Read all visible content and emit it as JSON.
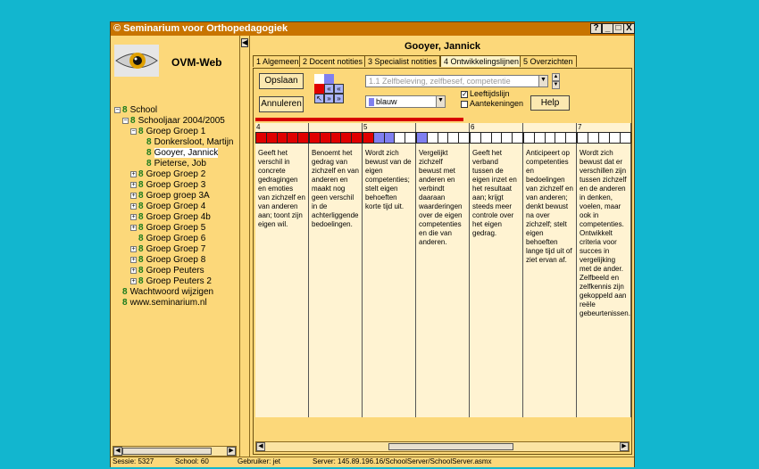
{
  "window": {
    "title": "© Seminarium voor Orthopedagogiek",
    "controls": [
      "?",
      "_",
      "□",
      "X"
    ]
  },
  "app_name": "OVM-Web",
  "tree": [
    {
      "label": "School",
      "toggle": "-",
      "level": 0
    },
    {
      "label": "Schooljaar 2004/2005",
      "toggle": "-",
      "level": 1
    },
    {
      "label": "Groep Groep 1",
      "toggle": "-",
      "level": 2
    },
    {
      "label": "Donkersloot, Martijn",
      "toggle": "",
      "level": 3
    },
    {
      "label": "Gooyer, Jannick",
      "toggle": "",
      "level": 3,
      "selected": true
    },
    {
      "label": "Pieterse, Job",
      "toggle": "",
      "level": 3
    },
    {
      "label": "Groep Groep 2",
      "toggle": "+",
      "level": 2
    },
    {
      "label": "Groep Groep 3",
      "toggle": "+",
      "level": 2
    },
    {
      "label": "Groep groep 3A",
      "toggle": "+",
      "level": 2
    },
    {
      "label": "Groep Groep 4",
      "toggle": "+",
      "level": 2
    },
    {
      "label": "Groep Groep 4b",
      "toggle": "+",
      "level": 2
    },
    {
      "label": "Groep Groep 5",
      "toggle": "+",
      "level": 2
    },
    {
      "label": "Groep Groep 6",
      "toggle": "",
      "level": 2
    },
    {
      "label": "Groep Groep 7",
      "toggle": "+",
      "level": 2
    },
    {
      "label": "Groep Groep 8",
      "toggle": "+",
      "level": 2
    },
    {
      "label": "Groep Peuters",
      "toggle": "+",
      "level": 2
    },
    {
      "label": "Groep Peuters 2",
      "toggle": "+",
      "level": 2
    },
    {
      "label": "Wachtwoord wijzigen",
      "toggle": "",
      "level": 0
    },
    {
      "label": "www.seminarium.nl",
      "toggle": "",
      "level": 0
    }
  ],
  "student_name": "Gooyer, Jannick",
  "tabs": [
    "1 Algemeen",
    "2 Docent notities",
    "3 Specialist notities",
    "4 Ontwikkelingslijnen",
    "5 Overzichten"
  ],
  "active_tab": 3,
  "buttons": {
    "save": "Opslaan",
    "cancel": "Annuleren",
    "help": "Help"
  },
  "nav_glyphs": {
    "prev": "«",
    "next": "»",
    "first": "«",
    "last": "»",
    "up": "↖"
  },
  "domain_select": "1.1 Zelfbeleving, zelfbesef, competentie",
  "color_select": "blauw",
  "checkboxes": [
    {
      "label": "Leeftijdslijn",
      "checked": true
    },
    {
      "label": "Aantekeningen",
      "checked": false
    }
  ],
  "columns": [
    {
      "num": "4",
      "cells": [
        "#e00000",
        "#e00000",
        "#e00000",
        "#e00000",
        "#e00000"
      ],
      "text": "Geeft het verschil in concrete gedragingen en emoties van zichzelf en van anderen aan; toont zijn eigen wil."
    },
    {
      "num": "",
      "cells": [
        "#e00000",
        "#e00000",
        "#e00000",
        "#e00000",
        "#e00000"
      ],
      "text": "Benoemt het gedrag van zichzelf en van anderen en maakt nog geen verschil in de achterliggende bedoelingen."
    },
    {
      "num": "5",
      "cells": [
        "#e00000",
        "#8080f0",
        "#8080f0",
        "#ffffff",
        "#ffffff"
      ],
      "text": "Wordt zich bewust van de eigen competenties; stelt eigen behoeften korte tijd uit."
    },
    {
      "num": "",
      "cells": [
        "#8080f0",
        "#ffffff",
        "#ffffff",
        "#ffffff",
        "#ffffff"
      ],
      "text": "Vergelijkt zichzelf bewust met anderen en verbindt daaraan waarderingen over de eigen competenties en die van anderen."
    },
    {
      "num": "6",
      "cells": [
        "#ffffff",
        "#ffffff",
        "#ffffff",
        "#ffffff",
        "#ffffff"
      ],
      "text": "Geeft het verband tussen de eigen inzet en het resultaat aan; krijgt steeds meer controle over het eigen gedrag."
    },
    {
      "num": "",
      "cells": [
        "#ffffff",
        "#ffffff",
        "#ffffff",
        "#ffffff",
        "#ffffff"
      ],
      "text": "Anticipeert op competenties en bedoelingen van zichzelf en van anderen; denkt bewust na over zichzelf; stelt eigen behoeften lange tijd uit of ziet ervan af."
    },
    {
      "num": "7",
      "cells": [
        "#ffffff",
        "#ffffff",
        "#ffffff",
        "#ffffff",
        "#ffffff"
      ],
      "text": "Wordt zich bewust dat er verschillen zijn tussen zichzelf en de anderen in denken, voelen, maar ook in competenties. Ontwikkelt criteria voor succes in vergelijking met de ander. Zelfbeeld en zelfkennis zijn gekoppeld aan reële gebeurtenissen."
    }
  ],
  "status": {
    "sessie": "Sessie: 5327",
    "school": "School: 60",
    "gebruiker": "Gebruiker: jet",
    "server": "Server: 145.89.196.16/SchoolServer/SchoolServer.asmx"
  },
  "colors": {
    "background": "#12b6cf",
    "window": "#fcd87a",
    "titlebar": "#c87400",
    "red": "#e00000",
    "blue": "#8080f0"
  }
}
